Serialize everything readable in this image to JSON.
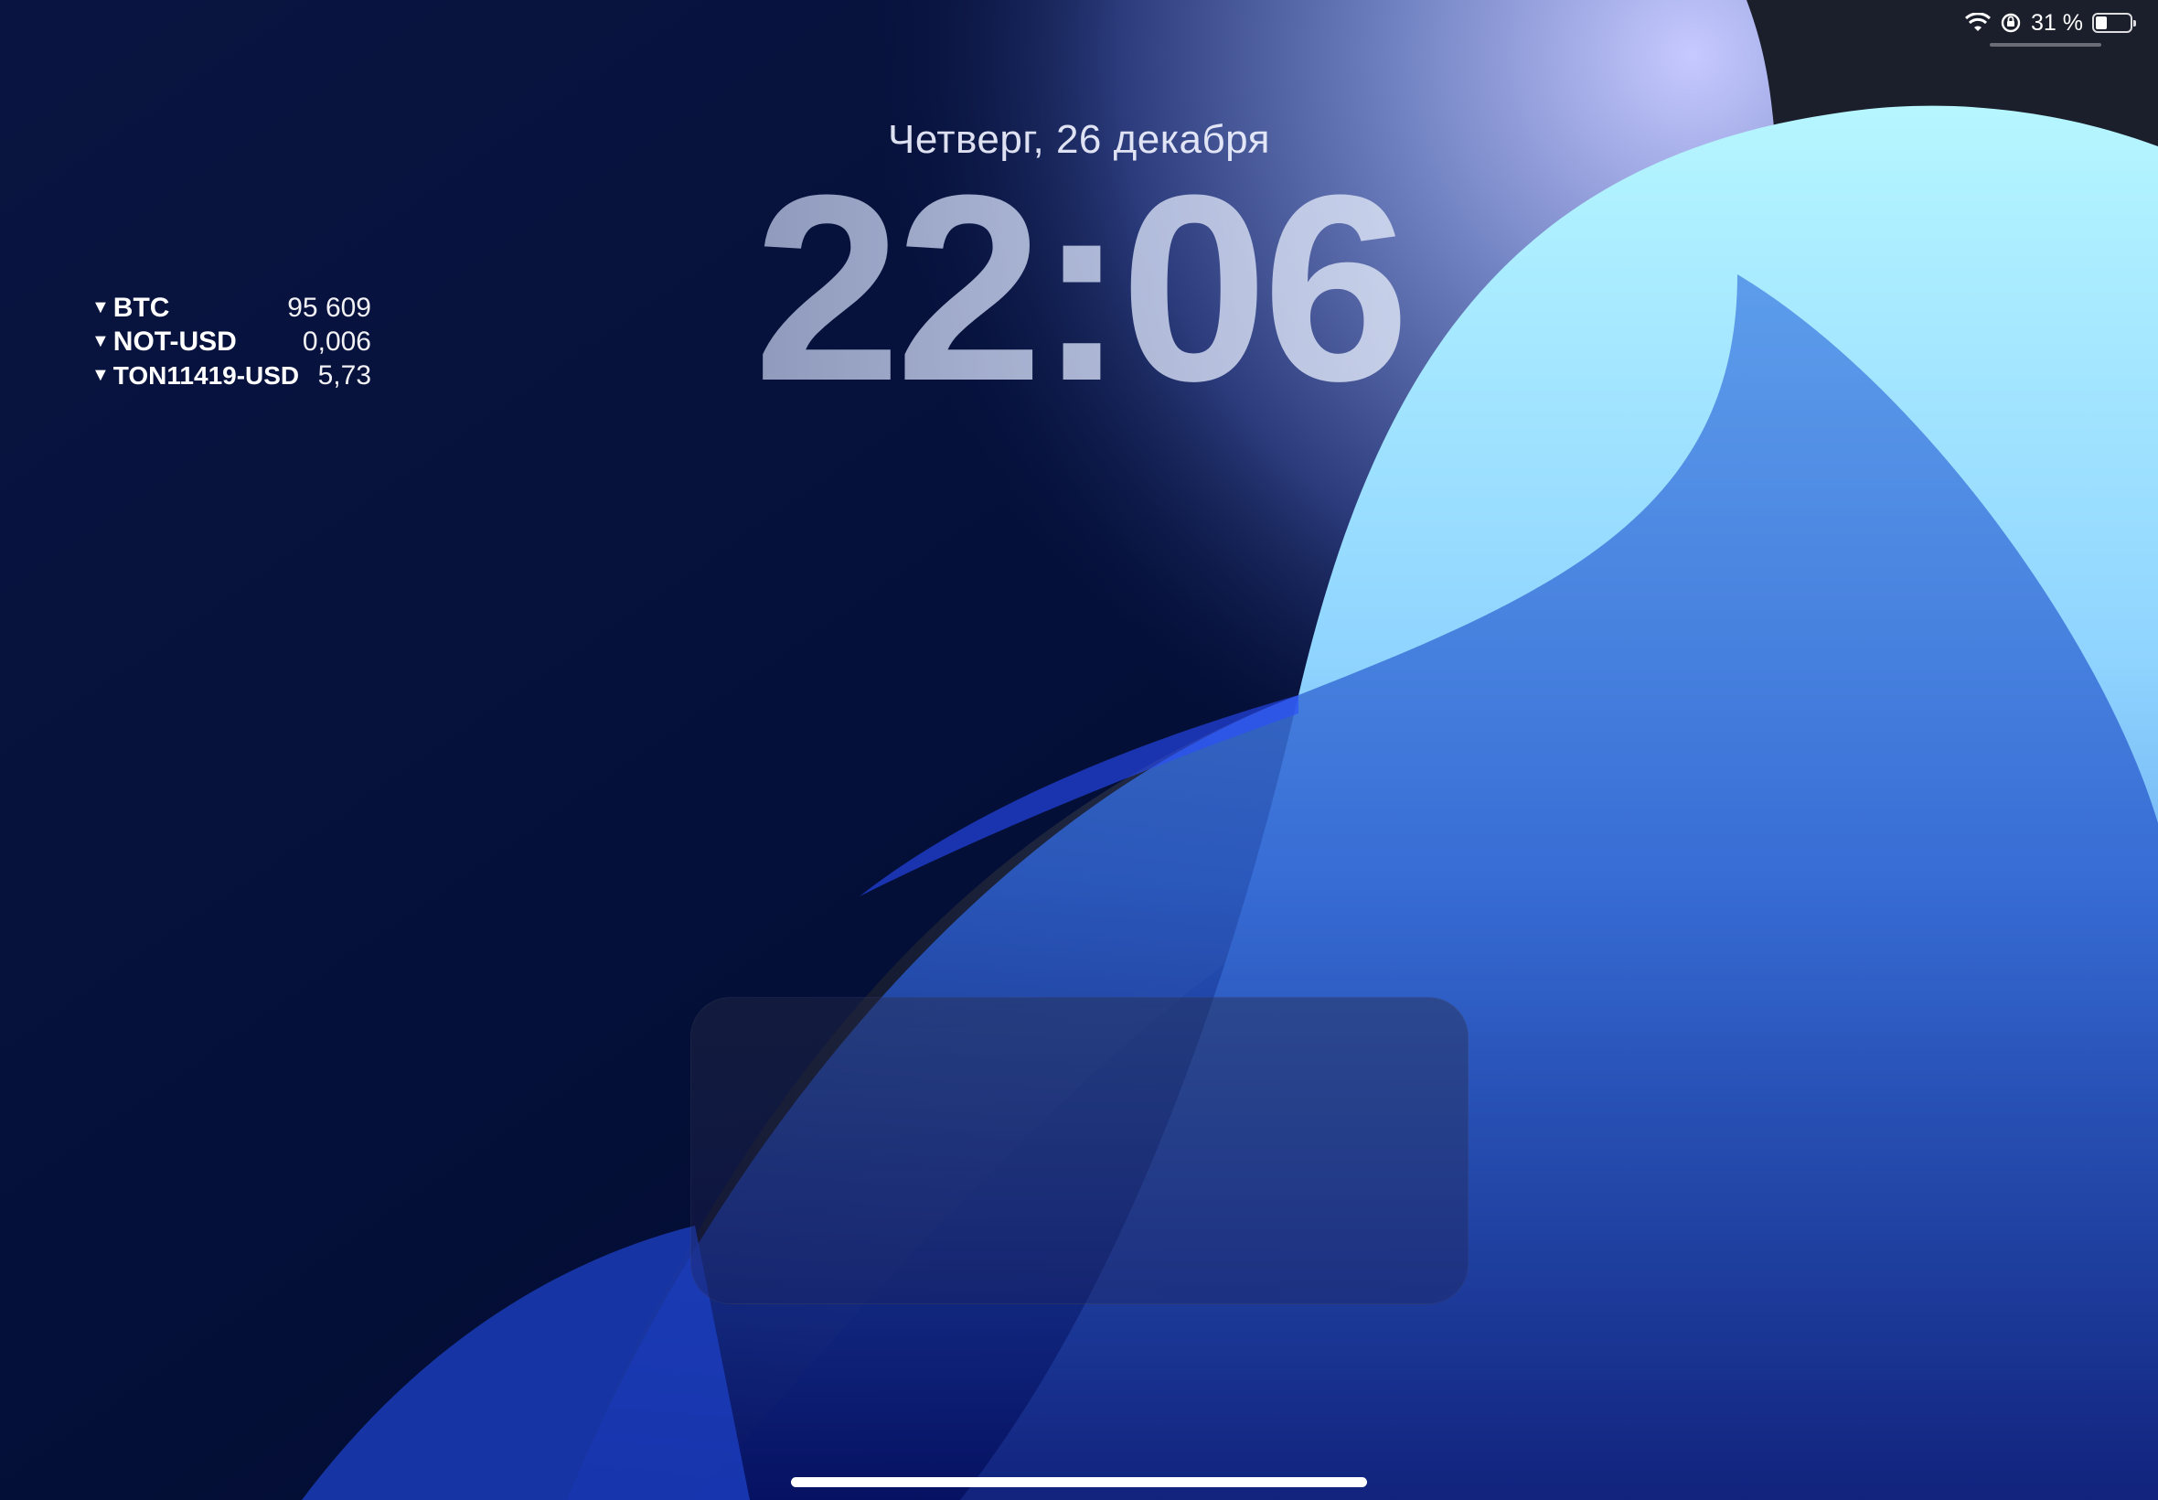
{
  "status_bar": {
    "battery_percent_label": "31 %",
    "battery_level": 0.31,
    "icons": [
      "wifi-icon",
      "orientation-lock-icon",
      "battery-icon"
    ]
  },
  "lock_screen": {
    "date": "Четверг, 26 декабря",
    "time_hours": "22",
    "time_separator": ":",
    "time_minutes": "06"
  },
  "stocks_widget": {
    "items": [
      {
        "symbol": "BTC",
        "value": "95 609",
        "direction": "down"
      },
      {
        "symbol": "NOT-USD",
        "value": "0,006",
        "direction": "down"
      },
      {
        "symbol": "TON11419-USD",
        "value": "5,73",
        "direction": "down"
      }
    ],
    "trend_glyph": "▼"
  },
  "colors": {
    "background_dark": "#020b2a",
    "accent_light_blue": "#8fd6ff",
    "accent_blue": "#3f7be0"
  }
}
